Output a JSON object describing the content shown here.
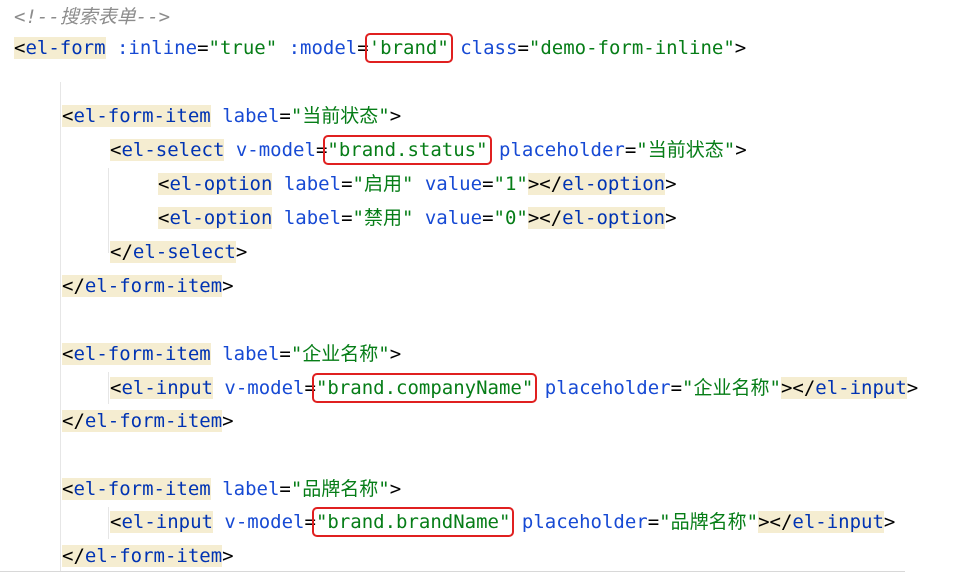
{
  "editor": {
    "language": "html",
    "lines": [
      {
        "tokens": [
          {
            "t": "comment",
            "v": "<!--搜索表单-->"
          }
        ]
      },
      {
        "tokens": [
          {
            "t": "punct",
            "v": "<"
          },
          {
            "t": "tag",
            "v": "el-form"
          },
          {
            "t": "space",
            "v": " "
          },
          {
            "t": "attr",
            "v": ":inline"
          },
          {
            "t": "punct",
            "v": "="
          },
          {
            "t": "str",
            "v": "\"true\""
          },
          {
            "t": "space",
            "v": " "
          },
          {
            "t": "attr",
            "v": ":model"
          },
          {
            "t": "punct",
            "v": "="
          },
          {
            "t": "str-hl",
            "v": "'brand\""
          },
          {
            "t": "space",
            "v": " "
          },
          {
            "t": "attr",
            "v": "class"
          },
          {
            "t": "punct",
            "v": "="
          },
          {
            "t": "str",
            "v": "\"demo-form-inline\""
          },
          {
            "t": "punct",
            "v": ">"
          }
        ]
      },
      {
        "tokens": []
      },
      {
        "indent": 1,
        "tokens": [
          {
            "t": "punct",
            "v": "<"
          },
          {
            "t": "tag",
            "v": "el-form-item"
          },
          {
            "t": "space",
            "v": " "
          },
          {
            "t": "attr",
            "v": "label"
          },
          {
            "t": "punct",
            "v": "="
          },
          {
            "t": "str",
            "v": "\"当前状态\""
          },
          {
            "t": "punct",
            "v": ">"
          }
        ]
      },
      {
        "indent": 2,
        "tokens": [
          {
            "t": "punct",
            "v": "<"
          },
          {
            "t": "tag",
            "v": "el-select"
          },
          {
            "t": "space",
            "v": " "
          },
          {
            "t": "attr",
            "v": "v-model"
          },
          {
            "t": "punct",
            "v": "="
          },
          {
            "t": "str-hl",
            "v": "\"brand.status\""
          },
          {
            "t": "space",
            "v": " "
          },
          {
            "t": "attr",
            "v": "placeholder"
          },
          {
            "t": "punct",
            "v": "="
          },
          {
            "t": "str",
            "v": "\"当前状态\""
          },
          {
            "t": "punct",
            "v": ">"
          }
        ]
      },
      {
        "indent": 3,
        "tokens": [
          {
            "t": "punct",
            "v": "<"
          },
          {
            "t": "tag",
            "v": "el-option"
          },
          {
            "t": "space",
            "v": " "
          },
          {
            "t": "attr",
            "v": "label"
          },
          {
            "t": "punct",
            "v": "="
          },
          {
            "t": "str",
            "v": "\"启用\""
          },
          {
            "t": "space",
            "v": " "
          },
          {
            "t": "attr",
            "v": "value"
          },
          {
            "t": "punct",
            "v": "="
          },
          {
            "t": "str",
            "v": "\"1\""
          },
          {
            "t": "punct",
            "v": "></"
          },
          {
            "t": "tag",
            "v": "el-option"
          },
          {
            "t": "punct",
            "v": ">"
          }
        ]
      },
      {
        "indent": 3,
        "tokens": [
          {
            "t": "punct",
            "v": "<"
          },
          {
            "t": "tag",
            "v": "el-option"
          },
          {
            "t": "space",
            "v": " "
          },
          {
            "t": "attr",
            "v": "label"
          },
          {
            "t": "punct",
            "v": "="
          },
          {
            "t": "str",
            "v": "\"禁用\""
          },
          {
            "t": "space",
            "v": " "
          },
          {
            "t": "attr",
            "v": "value"
          },
          {
            "t": "punct",
            "v": "="
          },
          {
            "t": "str",
            "v": "\"0\""
          },
          {
            "t": "punct",
            "v": "></"
          },
          {
            "t": "tag",
            "v": "el-option"
          },
          {
            "t": "punct",
            "v": ">"
          }
        ]
      },
      {
        "indent": 2,
        "tokens": [
          {
            "t": "punct",
            "v": "</"
          },
          {
            "t": "tag",
            "v": "el-select"
          },
          {
            "t": "punct",
            "v": ">"
          }
        ]
      },
      {
        "indent": 1,
        "tokens": [
          {
            "t": "punct",
            "v": "</"
          },
          {
            "t": "tag",
            "v": "el-form-item"
          },
          {
            "t": "punct",
            "v": ">"
          }
        ]
      },
      {
        "tokens": []
      },
      {
        "indent": 1,
        "tokens": [
          {
            "t": "punct",
            "v": "<"
          },
          {
            "t": "tag",
            "v": "el-form-item"
          },
          {
            "t": "space",
            "v": " "
          },
          {
            "t": "attr",
            "v": "label"
          },
          {
            "t": "punct",
            "v": "="
          },
          {
            "t": "str",
            "v": "\"企业名称\""
          },
          {
            "t": "punct",
            "v": ">"
          }
        ]
      },
      {
        "indent": 2,
        "tokens": [
          {
            "t": "punct",
            "v": "<"
          },
          {
            "t": "tag",
            "v": "el-input"
          },
          {
            "t": "space",
            "v": " "
          },
          {
            "t": "attr",
            "v": "v-model"
          },
          {
            "t": "punct",
            "v": "="
          },
          {
            "t": "str-hl",
            "v": "\"brand.companyName\""
          },
          {
            "t": "space",
            "v": " "
          },
          {
            "t": "attr",
            "v": "placeholder"
          },
          {
            "t": "punct",
            "v": "="
          },
          {
            "t": "str",
            "v": "\"企业名称\""
          },
          {
            "t": "punct",
            "v": "></"
          },
          {
            "t": "tag",
            "v": "el-input"
          },
          {
            "t": "punct",
            "v": ">"
          }
        ]
      },
      {
        "indent": 1,
        "tokens": [
          {
            "t": "punct",
            "v": "</"
          },
          {
            "t": "tag",
            "v": "el-form-item"
          },
          {
            "t": "punct",
            "v": ">"
          }
        ]
      },
      {
        "tokens": []
      },
      {
        "indent": 1,
        "tokens": [
          {
            "t": "punct",
            "v": "<"
          },
          {
            "t": "tag",
            "v": "el-form-item"
          },
          {
            "t": "space",
            "v": " "
          },
          {
            "t": "attr",
            "v": "label"
          },
          {
            "t": "punct",
            "v": "="
          },
          {
            "t": "str",
            "v": "\"品牌名称\""
          },
          {
            "t": "punct",
            "v": ">"
          }
        ]
      },
      {
        "indent": 2,
        "tokens": [
          {
            "t": "punct",
            "v": "<"
          },
          {
            "t": "tag",
            "v": "el-input"
          },
          {
            "t": "space",
            "v": " "
          },
          {
            "t": "attr",
            "v": "v-model"
          },
          {
            "t": "punct",
            "v": "="
          },
          {
            "t": "str-hl",
            "v": "\"brand.brandName\""
          },
          {
            "t": "space",
            "v": " "
          },
          {
            "t": "attr",
            "v": "placeholder"
          },
          {
            "t": "punct",
            "v": "="
          },
          {
            "t": "str",
            "v": "\"品牌名称\""
          },
          {
            "t": "punct",
            "v": "></"
          },
          {
            "t": "tag",
            "v": "el-input"
          },
          {
            "t": "punct",
            "v": ">"
          }
        ]
      },
      {
        "indent": 1,
        "tokens": [
          {
            "t": "punct",
            "v": "</"
          },
          {
            "t": "tag",
            "v": "el-form-item"
          },
          {
            "t": "punct",
            "v": ">"
          }
        ]
      }
    ]
  },
  "colors": {
    "tag": "#0033b3",
    "attribute": "#174ad4",
    "string": "#067d17",
    "comment": "#8c8c8c",
    "tag_background": "#f5edd1",
    "highlight_box": "#e02020"
  }
}
